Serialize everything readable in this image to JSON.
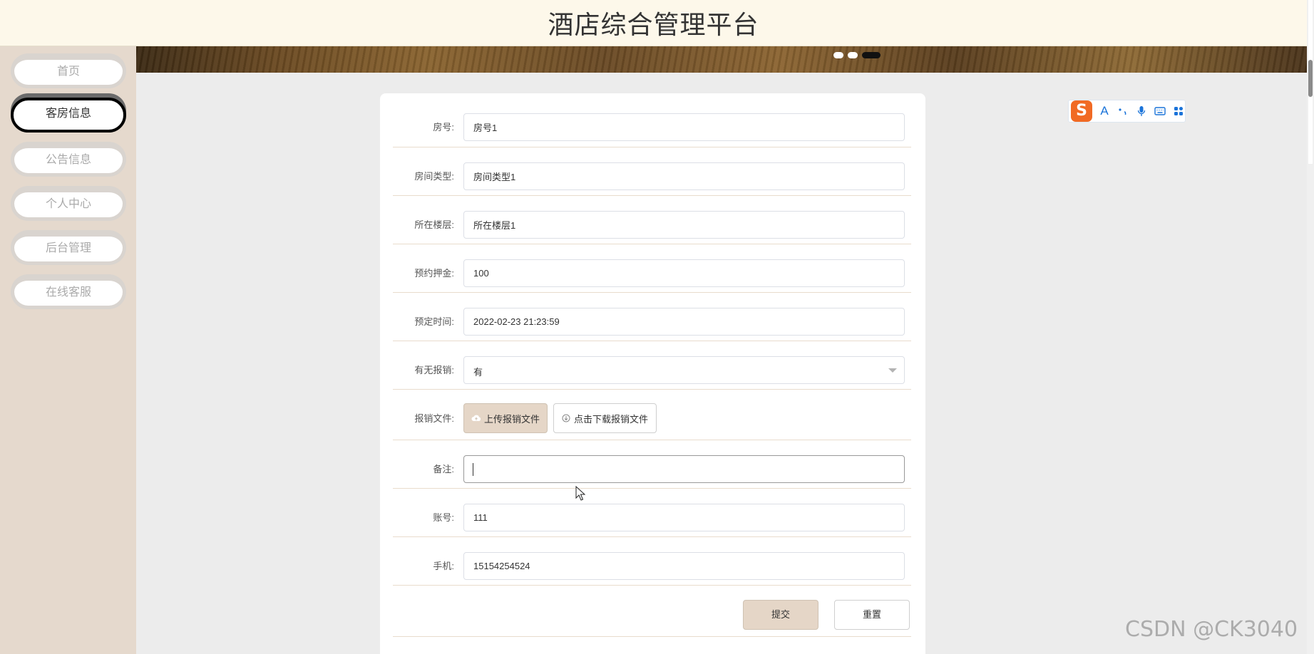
{
  "header": {
    "title": "酒店综合管理平台"
  },
  "sidebar": {
    "items": [
      {
        "label": "首页",
        "active": false
      },
      {
        "label": "客房信息",
        "active": true
      },
      {
        "label": "公告信息",
        "active": false
      },
      {
        "label": "个人中心",
        "active": false
      },
      {
        "label": "后台管理",
        "active": false
      },
      {
        "label": "在线客服",
        "active": false
      }
    ]
  },
  "form": {
    "room_no": {
      "label": "房号:",
      "value": "房号1"
    },
    "room_type": {
      "label": "房间类型:",
      "value": "房间类型1"
    },
    "floor": {
      "label": "所在楼层:",
      "value": "所在楼层1"
    },
    "deposit": {
      "label": "预约押金:",
      "value": "100"
    },
    "booking_time": {
      "label": "预定时间:",
      "value": "2022-02-23 21:23:59"
    },
    "reimbursement": {
      "label": "有无报销:",
      "value": "有"
    },
    "reimburse_file": {
      "label": "报销文件:",
      "upload_label": "上传报销文件",
      "download_label": "点击下载报销文件"
    },
    "remark": {
      "label": "备注:",
      "value": ""
    },
    "account": {
      "label": "账号:",
      "value": "111"
    },
    "phone": {
      "label": "手机:",
      "value": "15154254524"
    },
    "submit_label": "提交",
    "reset_label": "重置"
  },
  "ime_toolbar": {
    "logo": "S",
    "icons": [
      "font-icon",
      "punctuation-icon",
      "microphone-icon",
      "keyboard-icon",
      "apps-icon"
    ],
    "font_glyph": "A"
  },
  "watermark": "CSDN @CK3040",
  "colors": {
    "header_bg": "#fdf8ea",
    "sidebar_bg": "#e5d9cd",
    "primary_button": "#e5d6c7",
    "ime_logo": "#f16a24",
    "ime_icons": "#1a73d9"
  }
}
